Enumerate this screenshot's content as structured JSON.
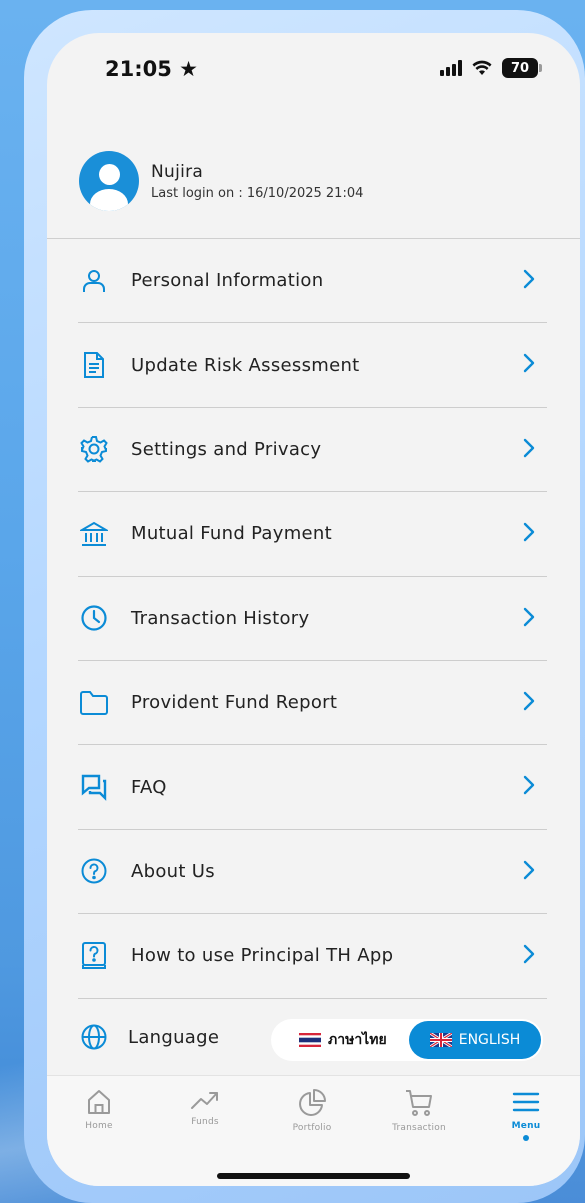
{
  "status_bar": {
    "time": "21:05",
    "battery": "70"
  },
  "profile": {
    "name": "Nujira",
    "last_login": "Last login on :  16/10/2025 21:04"
  },
  "menu": {
    "items": [
      {
        "label": "Personal Information",
        "icon": "person-icon"
      },
      {
        "label": "Update Risk Assessment",
        "icon": "document-icon"
      },
      {
        "label": "Settings and Privacy",
        "icon": "gear-icon"
      },
      {
        "label": "Mutual Fund Payment",
        "icon": "bank-icon"
      },
      {
        "label": "Transaction History",
        "icon": "clock-icon"
      },
      {
        "label": "Provident Fund Report",
        "icon": "folder-icon"
      },
      {
        "label": "FAQ",
        "icon": "chat-icon"
      },
      {
        "label": "About Us",
        "icon": "question-icon"
      },
      {
        "label": "How to use Principal TH App",
        "icon": "help-book-icon"
      }
    ]
  },
  "language": {
    "label": "Language",
    "thai_label": "ภาษาไทย",
    "english_label": "ENGLISH",
    "selected": "ENGLISH"
  },
  "bottom_nav": {
    "items": [
      {
        "label": "Home",
        "icon": "home-icon"
      },
      {
        "label": "Funds",
        "icon": "trend-icon"
      },
      {
        "label": "Portfolio",
        "icon": "pie-chart-icon"
      },
      {
        "label": "Transaction",
        "icon": "cart-icon"
      },
      {
        "label": "Menu",
        "icon": "menu-icon"
      }
    ],
    "active": "Menu"
  },
  "colors": {
    "accent": "#0b8bd6",
    "background": "#f3f3f3"
  }
}
